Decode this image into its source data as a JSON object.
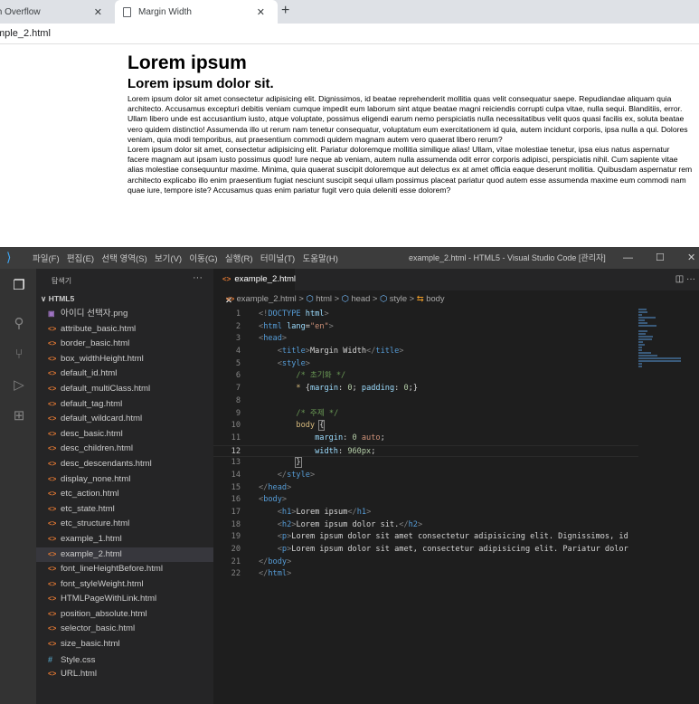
{
  "browser": {
    "tabs": [
      {
        "label": "th Overflow",
        "close": "✕"
      },
      {
        "label": "Margin Width",
        "close": "✕"
      }
    ],
    "new_tab": "+",
    "address": "mple_2.html"
  },
  "webpage": {
    "h1": "Lorem ipsum",
    "h2": "Lorem ipsum dolor sit.",
    "p1": "Lorem ipsum dolor sit amet consectetur adipisicing elit. Dignissimos, id beatae reprehenderit mollitia quas velit consequatur saepe. Repudiandae aliquam quia architecto. Accusamus excepturi debitis veniam cumque impedit eum laborum sint atque beatae magni reiciendis corrupti culpa vitae, nulla sequi. Blanditiis, error. Ullam libero unde est accusantium iusto, atque voluptate, possimus eligendi earum nemo perspiciatis nulla necessitatibus velit quos quasi facilis ex, soluta beatae vero quidem distinctio! Assumenda illo ut rerum nam tenetur consequatur, voluptatum eum exercitationem id quia, autem incidunt corporis, ipsa nulla a qui. Dolores veniam, quia modi temporibus, aut praesentium commodi quidem magnam autem vero quaerat libero rerum?",
    "p2": "Lorem ipsum dolor sit amet, consectetur adipisicing elit. Pariatur doloremque mollitia similique alias! Ullam, vitae molestiae tenetur, ipsa eius natus aspernatur facere magnam aut ipsam iusto possimus quod! Iure neque ab veniam, autem nulla assumenda odit error corporis adipisci, perspiciatis nihil. Cum sapiente vitae alias molestiae consequuntur maxime. Minima, quia quaerat suscipit doloremque aut delectus ex at amet officia eaque deserunt mollitia. Quibusdam aspernatur rem architecto explicabo illo enim praesentium fugiat nesciunt suscipit sequi ullam possimus placeat pariatur quod autem esse assumenda maxime eum commodi nam quae iure, tempore iste? Accusamus quas enim pariatur fugit vero quia deleniti esse dolorem?"
  },
  "vscode": {
    "menu": [
      "파일(F)",
      "편집(E)",
      "선택 영역(S)",
      "보기(V)",
      "이동(G)",
      "실행(R)",
      "터미널(T)",
      "도움말(H)"
    ],
    "window_title": "example_2.html - HTML5 - Visual Studio Code [관리자]",
    "win_buttons": {
      "minimize": "—",
      "maximize": "☐",
      "close": "✕"
    },
    "explorer_title": "탐색기",
    "explorer_more": "···",
    "folder": "∨ HTML5",
    "files": [
      {
        "name": "아이디 선택자.png",
        "icon": "▣"
      },
      {
        "name": "attribute_basic.html",
        "icon": "<>"
      },
      {
        "name": "border_basic.html",
        "icon": "<>"
      },
      {
        "name": "box_widthHeight.html",
        "icon": "<>"
      },
      {
        "name": "default_id.html",
        "icon": "<>"
      },
      {
        "name": "default_multiClass.html",
        "icon": "<>"
      },
      {
        "name": "default_tag.html",
        "icon": "<>"
      },
      {
        "name": "default_wildcard.html",
        "icon": "<>"
      },
      {
        "name": "desc_basic.html",
        "icon": "<>"
      },
      {
        "name": "desc_children.html",
        "icon": "<>"
      },
      {
        "name": "desc_descendants.html",
        "icon": "<>"
      },
      {
        "name": "display_none.html",
        "icon": "<>"
      },
      {
        "name": "etc_action.html",
        "icon": "<>"
      },
      {
        "name": "etc_state.html",
        "icon": "<>"
      },
      {
        "name": "etc_structure.html",
        "icon": "<>"
      },
      {
        "name": "example_1.html",
        "icon": "<>"
      },
      {
        "name": "example_2.html",
        "icon": "<>",
        "selected": true
      },
      {
        "name": "font_lineHeightBefore.html",
        "icon": "<>"
      },
      {
        "name": "font_styleWeight.html",
        "icon": "<>"
      },
      {
        "name": "HTMLPageWithLink.html",
        "icon": "<>"
      },
      {
        "name": "position_absolute.html",
        "icon": "<>"
      },
      {
        "name": "selector_basic.html",
        "icon": "<>"
      },
      {
        "name": "size_basic.html",
        "icon": "<>"
      },
      {
        "name": "Style.css",
        "icon": "#"
      },
      {
        "name": "URL.html",
        "icon": "<>"
      }
    ],
    "editor_tab": {
      "label": "example_2.html",
      "close": "✕"
    },
    "editor_actions": "◫  ···",
    "breadcrumb": [
      "example_2.html",
      "html",
      "head",
      "style",
      "body"
    ],
    "code": [
      {
        "n": "1",
        "tokens": [
          [
            "t-br",
            "<!"
          ],
          [
            "t-tag",
            "DOCTYPE"
          ],
          [
            "t-txt",
            " "
          ],
          [
            "t-attr",
            "html"
          ],
          [
            "t-br",
            ">"
          ]
        ]
      },
      {
        "n": "2",
        "tokens": [
          [
            "t-br",
            "<"
          ],
          [
            "t-tag",
            "html"
          ],
          [
            "t-txt",
            " "
          ],
          [
            "t-attr",
            "lang"
          ],
          [
            "t-txt",
            "="
          ],
          [
            "t-str",
            "\"en\""
          ],
          [
            "t-br",
            ">"
          ]
        ]
      },
      {
        "n": "3",
        "tokens": [
          [
            "t-br",
            "<"
          ],
          [
            "t-tag",
            "head"
          ],
          [
            "t-br",
            ">"
          ]
        ]
      },
      {
        "n": "4",
        "tokens": [
          [
            "t-txt",
            "    "
          ],
          [
            "t-br",
            "<"
          ],
          [
            "t-tag",
            "title"
          ],
          [
            "t-br",
            ">"
          ],
          [
            "t-txt",
            "Margin Width"
          ],
          [
            "t-br",
            "</"
          ],
          [
            "t-tag",
            "title"
          ],
          [
            "t-br",
            ">"
          ]
        ]
      },
      {
        "n": "5",
        "tokens": [
          [
            "t-txt",
            "    "
          ],
          [
            "t-br",
            "<"
          ],
          [
            "t-tag",
            "style"
          ],
          [
            "t-br",
            ">"
          ]
        ]
      },
      {
        "n": "6",
        "tokens": [
          [
            "t-txt",
            "        "
          ],
          [
            "t-com",
            "/* 초기화 */"
          ]
        ]
      },
      {
        "n": "7",
        "tokens": [
          [
            "t-txt",
            "        "
          ],
          [
            "t-sel",
            "*"
          ],
          [
            "t-txt",
            " {"
          ],
          [
            "t-prop",
            "margin"
          ],
          [
            "t-txt",
            ": "
          ],
          [
            "t-num",
            "0"
          ],
          [
            "t-txt",
            "; "
          ],
          [
            "t-prop",
            "padding"
          ],
          [
            "t-txt",
            ": "
          ],
          [
            "t-num",
            "0"
          ],
          [
            "t-txt",
            ";}"
          ]
        ]
      },
      {
        "n": "8",
        "tokens": []
      },
      {
        "n": "9",
        "tokens": [
          [
            "t-txt",
            "        "
          ],
          [
            "t-com",
            "/* 주제 */"
          ]
        ]
      },
      {
        "n": "10",
        "tokens": [
          [
            "t-txt",
            "        "
          ],
          [
            "t-sel",
            "body"
          ],
          [
            "t-txt",
            " "
          ],
          [
            "t-brace",
            "{"
          ]
        ]
      },
      {
        "n": "11",
        "tokens": [
          [
            "t-txt",
            "            "
          ],
          [
            "t-prop",
            "margin"
          ],
          [
            "t-txt",
            ": "
          ],
          [
            "t-num",
            "0"
          ],
          [
            "t-txt",
            " "
          ],
          [
            "t-kw",
            "auto"
          ],
          [
            "t-txt",
            ";"
          ]
        ]
      },
      {
        "n": "12",
        "current": true,
        "tokens": [
          [
            "t-txt",
            "            "
          ],
          [
            "t-prop",
            "width"
          ],
          [
            "t-txt",
            ": "
          ],
          [
            "t-num",
            "960px"
          ],
          [
            "t-txt",
            ";"
          ]
        ]
      },
      {
        "n": "13",
        "tokens": [
          [
            "t-txt",
            "        "
          ],
          [
            "t-brace",
            "}"
          ]
        ]
      },
      {
        "n": "14",
        "tokens": [
          [
            "t-txt",
            "    "
          ],
          [
            "t-br",
            "</"
          ],
          [
            "t-tag",
            "style"
          ],
          [
            "t-br",
            ">"
          ]
        ]
      },
      {
        "n": "15",
        "tokens": [
          [
            "t-br",
            "</"
          ],
          [
            "t-tag",
            "head"
          ],
          [
            "t-br",
            ">"
          ]
        ]
      },
      {
        "n": "16",
        "tokens": [
          [
            "t-br",
            "<"
          ],
          [
            "t-tag",
            "body"
          ],
          [
            "t-br",
            ">"
          ]
        ]
      },
      {
        "n": "17",
        "tokens": [
          [
            "t-txt",
            "    "
          ],
          [
            "t-br",
            "<"
          ],
          [
            "t-tag",
            "h1"
          ],
          [
            "t-br",
            ">"
          ],
          [
            "t-txt",
            "Lorem ipsum"
          ],
          [
            "t-br",
            "</"
          ],
          [
            "t-tag",
            "h1"
          ],
          [
            "t-br",
            ">"
          ]
        ]
      },
      {
        "n": "18",
        "tokens": [
          [
            "t-txt",
            "    "
          ],
          [
            "t-br",
            "<"
          ],
          [
            "t-tag",
            "h2"
          ],
          [
            "t-br",
            ">"
          ],
          [
            "t-txt",
            "Lorem ipsum dolor sit."
          ],
          [
            "t-br",
            "</"
          ],
          [
            "t-tag",
            "h2"
          ],
          [
            "t-br",
            ">"
          ]
        ]
      },
      {
        "n": "19",
        "tokens": [
          [
            "t-txt",
            "    "
          ],
          [
            "t-br",
            "<"
          ],
          [
            "t-tag",
            "p"
          ],
          [
            "t-br",
            ">"
          ],
          [
            "t-txt",
            "Lorem ipsum dolor sit amet consectetur adipisicing elit. Dignissimos, id"
          ]
        ]
      },
      {
        "n": "20",
        "tokens": [
          [
            "t-txt",
            "    "
          ],
          [
            "t-br",
            "<"
          ],
          [
            "t-tag",
            "p"
          ],
          [
            "t-br",
            ">"
          ],
          [
            "t-txt",
            "Lorem ipsum dolor sit amet, consectetur adipisicing elit. Pariatur dolor"
          ]
        ]
      },
      {
        "n": "21",
        "tokens": [
          [
            "t-br",
            "</"
          ],
          [
            "t-tag",
            "body"
          ],
          [
            "t-br",
            ">"
          ]
        ]
      },
      {
        "n": "22",
        "tokens": [
          [
            "t-br",
            "</"
          ],
          [
            "t-tag",
            "html"
          ],
          [
            "t-br",
            ">"
          ]
        ]
      }
    ]
  }
}
